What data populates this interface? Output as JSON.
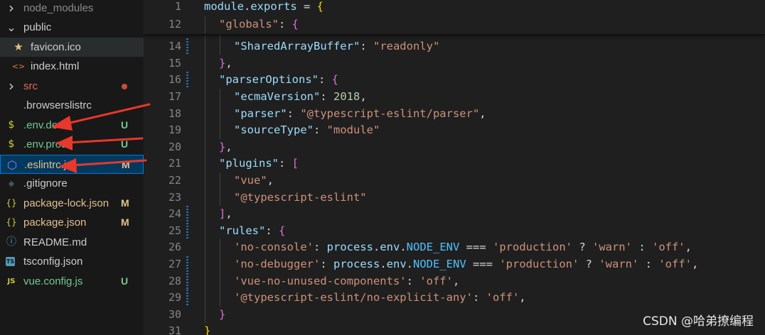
{
  "explorer": {
    "items": [
      {
        "name": "node_modules",
        "kind": "folder",
        "open": false,
        "indent": 0,
        "color": "#8b8b8b",
        "icon": "chevron-right-icon"
      },
      {
        "name": "public",
        "kind": "folder",
        "open": true,
        "indent": 0,
        "color": "#cccccc",
        "icon": "chevron-down-icon"
      },
      {
        "name": "favicon.ico",
        "kind": "file",
        "indent": 1,
        "color": "#cccccc",
        "icon": "star-icon",
        "highlight": true
      },
      {
        "name": "index.html",
        "kind": "file",
        "indent": 1,
        "color": "#cccccc",
        "icon": "html-icon"
      },
      {
        "name": "src",
        "kind": "folder",
        "open": false,
        "indent": 0,
        "color": "#e06c5b",
        "icon": "chevron-right-icon",
        "dot": "#c74e39"
      },
      {
        "name": ".browserslistrc",
        "kind": "file",
        "indent": 0,
        "color": "#cccccc",
        "icon": "blank-icon"
      },
      {
        "name": ".env.dev",
        "kind": "file",
        "indent": 0,
        "color": "#73c991",
        "icon": "dollar-icon",
        "badge": "U"
      },
      {
        "name": ".env.prod",
        "kind": "file",
        "indent": 0,
        "color": "#73c991",
        "icon": "dollar-icon",
        "badge": "U"
      },
      {
        "name": ".eslintrc.js",
        "kind": "file",
        "indent": 0,
        "color": "#e2c08d",
        "icon": "eslint-icon",
        "badge": "M",
        "selected": true
      },
      {
        "name": ".gitignore",
        "kind": "file",
        "indent": 0,
        "color": "#cccccc",
        "icon": "git-icon"
      },
      {
        "name": "package-lock.json",
        "kind": "file",
        "indent": 0,
        "color": "#e2c08d",
        "icon": "json-icon",
        "badge": "M"
      },
      {
        "name": "package.json",
        "kind": "file",
        "indent": 0,
        "color": "#e2c08d",
        "icon": "json-icon",
        "badge": "M"
      },
      {
        "name": "README.md",
        "kind": "file",
        "indent": 0,
        "color": "#cccccc",
        "icon": "info-icon"
      },
      {
        "name": "tsconfig.json",
        "kind": "file",
        "indent": 0,
        "color": "#cccccc",
        "icon": "ts-icon"
      },
      {
        "name": "vue.config.js",
        "kind": "file",
        "indent": 0,
        "color": "#73c991",
        "icon": "js-icon",
        "badge": "U"
      }
    ]
  },
  "colors": {
    "untracked": "#73c991",
    "modified": "#e2c08d",
    "selection_bg": "#04395e",
    "selection_border": "#0078d4",
    "arrow": "#e8372c"
  },
  "editor": {
    "sticky": [
      {
        "n": "1",
        "depth": 0,
        "tokens": [
          [
            "t-obj",
            "module"
          ],
          [
            "t-punc",
            "."
          ],
          [
            "t-obj",
            "exports"
          ],
          [
            "t-punc",
            " = "
          ],
          [
            "t-b1",
            "{"
          ]
        ]
      },
      {
        "n": "12",
        "depth": 1,
        "tokens": [
          [
            "t-str",
            "\"globals\""
          ],
          [
            "t-punc",
            ": "
          ],
          [
            "t-b2",
            "{"
          ]
        ]
      }
    ],
    "lines": [
      {
        "n": "14",
        "depth": 2,
        "mark": true,
        "tokens": [
          [
            "t-key",
            "\"SharedArrayBuffer\""
          ],
          [
            "t-punc",
            ": "
          ],
          [
            "t-str",
            "\"readonly\""
          ]
        ]
      },
      {
        "n": "15",
        "depth": 1,
        "tokens": [
          [
            "t-b2",
            "}"
          ],
          [
            "t-punc",
            ","
          ]
        ]
      },
      {
        "n": "16",
        "depth": 1,
        "mark": true,
        "tokens": [
          [
            "t-key",
            "\"parserOptions\""
          ],
          [
            "t-punc",
            ": "
          ],
          [
            "t-b2",
            "{"
          ]
        ]
      },
      {
        "n": "17",
        "depth": 2,
        "tokens": [
          [
            "t-key",
            "\"ecmaVersion\""
          ],
          [
            "t-punc",
            ": "
          ],
          [
            "t-num",
            "2018"
          ],
          [
            "t-punc",
            ","
          ]
        ]
      },
      {
        "n": "18",
        "depth": 2,
        "tokens": [
          [
            "t-key",
            "\"parser\""
          ],
          [
            "t-punc",
            ": "
          ],
          [
            "t-str",
            "\"@typescript-eslint/parser\""
          ],
          [
            "t-punc",
            ","
          ]
        ]
      },
      {
        "n": "19",
        "depth": 2,
        "tokens": [
          [
            "t-key",
            "\"sourceType\""
          ],
          [
            "t-punc",
            ": "
          ],
          [
            "t-str",
            "\"module\""
          ]
        ]
      },
      {
        "n": "20",
        "depth": 1,
        "tokens": [
          [
            "t-b2",
            "}"
          ],
          [
            "t-punc",
            ","
          ]
        ]
      },
      {
        "n": "21",
        "depth": 1,
        "tokens": [
          [
            "t-key",
            "\"plugins\""
          ],
          [
            "t-punc",
            ": "
          ],
          [
            "t-b2",
            "["
          ]
        ]
      },
      {
        "n": "22",
        "depth": 2,
        "tokens": [
          [
            "t-str",
            "\"vue\""
          ],
          [
            "t-punc",
            ","
          ]
        ]
      },
      {
        "n": "23",
        "depth": 2,
        "tokens": [
          [
            "t-str",
            "\"@typescript-eslint\""
          ]
        ]
      },
      {
        "n": "24",
        "depth": 1,
        "mark": true,
        "tokens": [
          [
            "t-b2",
            "]"
          ],
          [
            "t-punc",
            ","
          ]
        ]
      },
      {
        "n": "25",
        "depth": 1,
        "mark": true,
        "tokens": [
          [
            "t-key",
            "\"rules\""
          ],
          [
            "t-punc",
            ": "
          ],
          [
            "t-b2",
            "{"
          ]
        ]
      },
      {
        "n": "26",
        "depth": 2,
        "tokens": [
          [
            "t-str",
            "'no-console'"
          ],
          [
            "t-punc",
            ": "
          ],
          [
            "t-obj",
            "process"
          ],
          [
            "t-punc",
            "."
          ],
          [
            "t-obj",
            "env"
          ],
          [
            "t-punc",
            "."
          ],
          [
            "t-const",
            "NODE_ENV"
          ],
          [
            "t-punc",
            " === "
          ],
          [
            "t-str",
            "'production'"
          ],
          [
            "t-punc",
            " ? "
          ],
          [
            "t-str",
            "'warn'"
          ],
          [
            "t-punc",
            " : "
          ],
          [
            "t-str",
            "'off'"
          ],
          [
            "t-punc",
            ","
          ]
        ]
      },
      {
        "n": "27",
        "depth": 2,
        "mark": true,
        "tokens": [
          [
            "t-str",
            "'no-debugger'"
          ],
          [
            "t-punc",
            ": "
          ],
          [
            "t-obj",
            "process"
          ],
          [
            "t-punc",
            "."
          ],
          [
            "t-obj",
            "env"
          ],
          [
            "t-punc",
            "."
          ],
          [
            "t-const",
            "NODE_ENV"
          ],
          [
            "t-punc",
            " === "
          ],
          [
            "t-str",
            "'production'"
          ],
          [
            "t-punc",
            " ? "
          ],
          [
            "t-str",
            "'warn'"
          ],
          [
            "t-punc",
            " : "
          ],
          [
            "t-str",
            "'off'"
          ],
          [
            "t-punc",
            ","
          ]
        ]
      },
      {
        "n": "28",
        "depth": 2,
        "mark": true,
        "tokens": [
          [
            "t-str",
            "'vue-no-unused-components'"
          ],
          [
            "t-punc",
            ": "
          ],
          [
            "t-str",
            "'off'"
          ],
          [
            "t-punc",
            ","
          ]
        ]
      },
      {
        "n": "29",
        "depth": 2,
        "mark": true,
        "tokens": [
          [
            "t-str",
            "'@typescript-eslint/no-explicit-any'"
          ],
          [
            "t-punc",
            ": "
          ],
          [
            "t-str",
            "'off'"
          ],
          [
            "t-punc",
            ","
          ]
        ]
      },
      {
        "n": "30",
        "depth": 1,
        "tokens": [
          [
            "t-b2",
            "}"
          ]
        ]
      },
      {
        "n": "31",
        "depth": 0,
        "tokens": [
          [
            "t-b1",
            "}"
          ]
        ]
      }
    ]
  },
  "watermark": "CSDN @哈弟撩编程"
}
